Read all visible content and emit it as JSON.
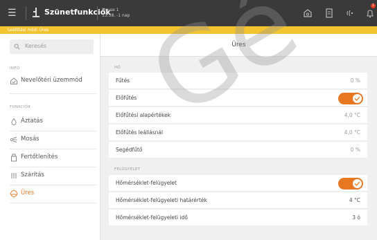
{
  "topbar": {
    "title": "Szünetfunkciók",
    "device_name": "House 1",
    "device_status": "13:38, -1 nap",
    "notification_count": "1"
  },
  "notice": {
    "text": "Leállítási mód: Üres"
  },
  "sidebar": {
    "search_placeholder": "Keresés",
    "section_info": "INFÓ",
    "section_functions": "FUNKCIÓK",
    "items": [
      {
        "label": "Nevelőtéri üzemmód",
        "icon": "mode-icon"
      },
      {
        "label": "Áztatás",
        "icon": "soak-icon"
      },
      {
        "label": "Mosás",
        "icon": "wash-icon"
      },
      {
        "label": "Fertőtlenítés",
        "icon": "disinfect-icon"
      },
      {
        "label": "Szárítás",
        "icon": "dry-icon"
      },
      {
        "label": "Üres",
        "icon": "empty-icon",
        "active": true
      }
    ]
  },
  "main": {
    "title": "Üres",
    "group_heat": "HŐ",
    "group_monitor": "FELÜGYELET",
    "rows": [
      {
        "label": "Fűtés",
        "value": "0 %"
      },
      {
        "label": "Előfűtés",
        "toggle": true
      },
      {
        "label": "Előfűtési alapértékek",
        "value": "4,0 °C"
      },
      {
        "label": "Előfűtés leállásnál",
        "value": "4,0 °C"
      },
      {
        "label": "Segédfűtő",
        "value": "0 %"
      },
      {
        "label": "Hőmérséklet-felügyelet",
        "toggle": true
      },
      {
        "label": "Hőmérséklet-felügyeleti határérték",
        "value": "4 °C"
      },
      {
        "label": "Hőmérséklet-felügyeleti idő",
        "value": "3 ó"
      }
    ]
  },
  "watermark": "Gé",
  "colors": {
    "accent": "#e87722",
    "topbar": "#3a3a3a",
    "notice": "#f3c330"
  }
}
